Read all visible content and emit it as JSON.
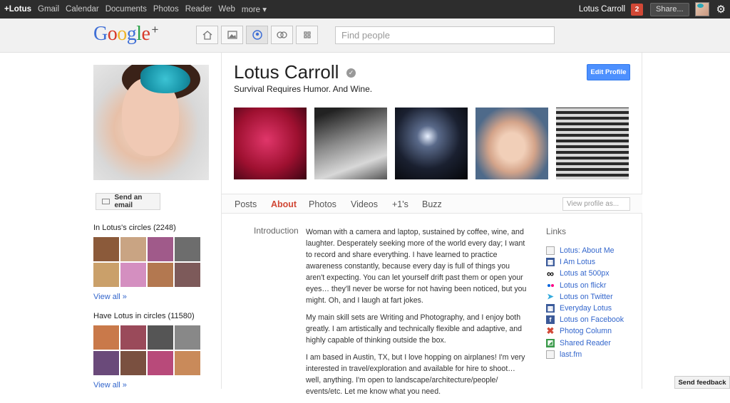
{
  "topbar": {
    "nav": [
      "+Lotus",
      "Gmail",
      "Calendar",
      "Documents",
      "Photos",
      "Reader",
      "Web",
      "more ▾"
    ],
    "user": "Lotus Carroll",
    "notifications": "2",
    "share": "Share...",
    "settings_icon": "gear-icon"
  },
  "header": {
    "logo_text": "Google",
    "logo_plus": "+",
    "search_placeholder": "Find people",
    "nav_icons": [
      "home-icon",
      "photos-icon",
      "profile-icon",
      "circles-icon",
      "games-icon"
    ]
  },
  "profile": {
    "name": "Lotus Carroll",
    "tagline": "Survival Requires Humor. And Wine.",
    "edit_button": "Edit Profile",
    "email_button": "Send an email"
  },
  "circles": {
    "in_title": "In Lotus's circles (2248)",
    "have_title": "Have Lotus in circles (11580)",
    "view_all": "View all »"
  },
  "tabs": [
    "Posts",
    "About",
    "Photos",
    "Videos",
    "+1's",
    "Buzz"
  ],
  "active_tab": "About",
  "view_profile_as": "View profile as...",
  "about": {
    "intro_label": "Introduction",
    "paragraphs": [
      "Woman with a camera and laptop, sustained by coffee, wine, and laughter. Desperately seeking more of the world every day; I want to record and share everything. I have learned to practice awareness constantly, because every day is full of things you aren't expecting. You can let yourself drift past them or open your eyes… they'll never be worse for not having been noticed, but you might. Oh, and I laugh at fart jokes.",
      "My main skill sets are Writing and Photography, and I enjoy both greatly. I am artistically and technically flexible and adaptive, and highly capable of thinking outside the box.",
      "I am based in Austin, TX, but I love hopping on airplanes! I'm very interested in travel/exploration and available for hire to shoot… well, anything. I'm open to landscape/architecture/people/ events/etc. Let me know what you need."
    ]
  },
  "links": {
    "title": "Links",
    "items": [
      "Lotus: About Me",
      "I Am Lotus",
      "Lotus at 500px",
      "Lotus on flickr",
      "Lotus on Twitter",
      "Everyday Lotus",
      "Lotus on Facebook",
      "Photog Column",
      "Shared Reader",
      "last.fm"
    ]
  },
  "feedback": "Send feedback",
  "colors": {
    "accent_red": "#d14836",
    "link_blue": "#3366cc",
    "button_blue": "#4d90fe"
  }
}
